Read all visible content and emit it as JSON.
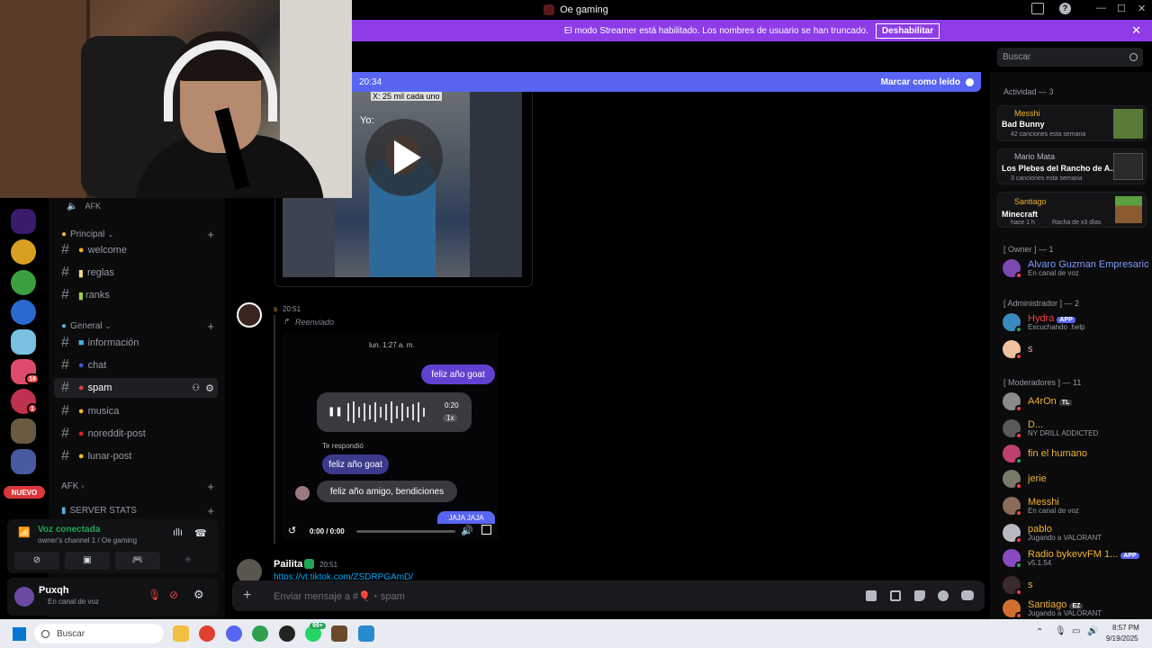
{
  "window": {
    "title": "Oe gaming"
  },
  "streamer_bar": {
    "message": "El modo Streamer está habilitado. Los nombres de usuario se han truncado.",
    "button": "Deshabilitar"
  },
  "header": {
    "search_placeholder": "Buscar"
  },
  "new_messages_bar": {
    "time": "20:34",
    "mark_read": "Marcar como leído"
  },
  "channels": {
    "afk_top": "AFK",
    "categories": [
      {
        "name": "Principal"
      },
      {
        "name": "General"
      },
      {
        "name": "AFK"
      },
      {
        "name": "SERVER STATS"
      }
    ],
    "items": [
      {
        "label": "welcome"
      },
      {
        "label": "reglas"
      },
      {
        "label": "ranks"
      },
      {
        "label": "información"
      },
      {
        "label": "chat"
      },
      {
        "label": "spam"
      },
      {
        "label": "musica"
      },
      {
        "label": "noreddit-post"
      },
      {
        "label": "lunar-post"
      }
    ]
  },
  "servers": {
    "nuevo": "NUEVO",
    "badge_18": "18",
    "badge_1": "1"
  },
  "voice": {
    "status": "Voz conectada",
    "channel": "owner's channel 1 / Oe gaming"
  },
  "user": {
    "name": "Puxqh",
    "status": "En canal de voz"
  },
  "messages": {
    "video1_caption_top": "X: 25 mil cada uno",
    "video1_caption_yo": "Yo:",
    "msg2_author": "s",
    "msg2_time": "20:51",
    "forwarded": "Reenviado",
    "chat_date": "lun. 1:27 a. m.",
    "bubble1": "feliz año goat",
    "audio_time": "0:20",
    "audio_speed": "1x",
    "replied_label": "Te respondió",
    "reply_quote": "feliz año goat",
    "reply_text": "feliz año amigo, bendiciones",
    "bubble_partial": "JAJA JAJA",
    "video2_time": "0:00 / 0:00",
    "msg3_author": "Pailita",
    "msg3_time": "20:51",
    "msg3_link": "https://vt.tiktok.com/ZSDRPGAmD/"
  },
  "composer": {
    "placeholder": "Enviar mensaje a #🎈・spam"
  },
  "members": {
    "activity_header": "Actividad — 3",
    "activities": [
      {
        "user": "Messhi",
        "title": "Bad Bunny",
        "sub": "42 canciones esta semana"
      },
      {
        "user": "Mario Mata",
        "title": "Los Plebes del Rancho de A...",
        "sub": "3 canciones esta semana"
      },
      {
        "user": "Santiago",
        "title": "Minecraft",
        "sub": "hace 1 h",
        "extra": "Racha de x3 días"
      }
    ],
    "groups": {
      "owner": "[ Owner ] — 1",
      "admin": "[ Administrador ] — 2",
      "mods": "[ Moderadores ] — 11"
    },
    "list": [
      {
        "name": "Alvaro Guzman Empresario",
        "status": "En canal de voz",
        "color": "#7c9cff"
      },
      {
        "name": "Hydra",
        "status": "Escuchando .help",
        "color": "#f23f43",
        "tag": "APP"
      },
      {
        "name": "s",
        "status": "",
        "color": "#f0a0a0"
      },
      {
        "name": "A4rOn",
        "status": "",
        "color": "#f0b232",
        "tag": "TL"
      },
      {
        "name": "D...",
        "status": "NY DRILL ADDICTED",
        "color": "#f0b232"
      },
      {
        "name": "fin el humano",
        "status": "",
        "color": "#f0b232"
      },
      {
        "name": "jerie",
        "status": "",
        "color": "#f0b232"
      },
      {
        "name": "Messhi",
        "status": "En canal de voz",
        "color": "#f0b232"
      },
      {
        "name": "pablo",
        "status": "Jugando a VALORANT",
        "color": "#f0b232"
      },
      {
        "name": "Radio bykevvFM 1...",
        "status": "v5.1.54",
        "color": "#f0b232",
        "tag": "APP"
      },
      {
        "name": "s",
        "status": "",
        "color": "#f0b232"
      },
      {
        "name": "Santiago",
        "status": "Jugando a VALORANT",
        "color": "#f0b232",
        "tag": "EZ"
      }
    ]
  },
  "taskbar": {
    "search": "Buscar",
    "badge": "99+",
    "time": "8:57 PM",
    "date": "9/19/2025"
  }
}
